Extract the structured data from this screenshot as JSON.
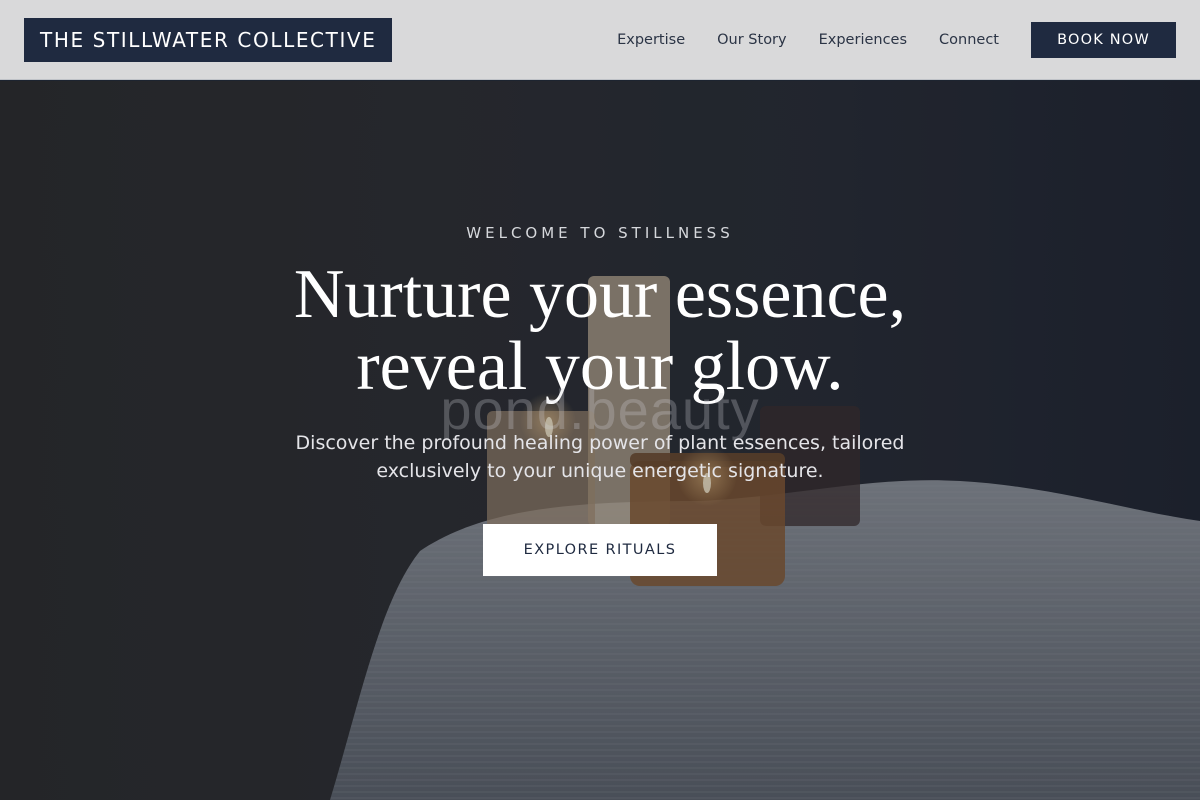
{
  "header": {
    "logo": "THE STILLWATER COLLECTIVE",
    "nav": [
      "Expertise",
      "Our Story",
      "Experiences",
      "Connect"
    ],
    "book_button": "BOOK NOW"
  },
  "hero": {
    "eyebrow": "WELCOME TO STILLNESS",
    "headline_line1": "Nurture your essence,",
    "headline_line2": "reveal your glow.",
    "watermark": "pond.beauty",
    "subtext_line1": "Discover the profound healing power of plant essences, tailored",
    "subtext_line2": "exclusively to your unique energetic signature.",
    "cta": "EXPLORE RITUALS"
  },
  "colors": {
    "brand_navy": "#1f2a40",
    "header_bg": "#d9d9da",
    "cta_bg": "#ffffff"
  }
}
